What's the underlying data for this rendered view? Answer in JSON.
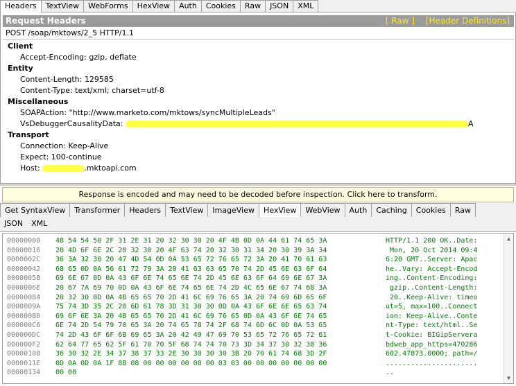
{
  "request_tabs": [
    "Headers",
    "TextView",
    "WebForms",
    "HexView",
    "Auth",
    "Cookies",
    "Raw",
    "JSON",
    "XML"
  ],
  "request_active_tab": "Headers",
  "request_panel": {
    "title": "Request Headers",
    "raw_link": "[ Raw ]",
    "defs_link": "[Header Definitions]",
    "request_line": "POST /soap/mktows/2_5 HTTP/1.1",
    "groups": {
      "client": "Client",
      "entity": "Entity",
      "misc": "Miscellaneous",
      "transport": "Transport"
    },
    "headers": {
      "accept_encoding": "Accept-Encoding: gzip, deflate",
      "content_length": "Content-Length: 129585",
      "content_type": "Content-Type: text/xml; charset=utf-8",
      "soap_action": "SOAPAction: \"http://www.marketo.com/mktows/syncMultipleLeads\"",
      "vs_debugger": "VsDebuggerCausalityData: ",
      "vs_debugger_tail": "A",
      "connection": "Connection: Keep-Alive",
      "expect": "Expect: 100-continue",
      "host_prefix": "Host: ",
      "host_suffix": ".mktoapi.com"
    }
  },
  "notice": "Response is encoded and may need to be decoded before inspection. Click here to transform.",
  "response_tabs_row1": [
    "Get SyntaxView",
    "Transformer",
    "Headers",
    "TextView",
    "ImageView",
    "HexView",
    "WebView",
    "Auth",
    "Caching",
    "Cookies",
    "Raw"
  ],
  "response_tabs_row2": [
    "JSON",
    "XML"
  ],
  "response_active_tab": "HexView",
  "hex_rows": [
    {
      "offset": "00000000",
      "bytes": "48 54 54 50 2F 31 2E 31 20 32 30 30 20 4F 4B 0D 0A 44 61 74 65 3A",
      "ascii": "HTTP/1.1 200 OK..Date:"
    },
    {
      "offset": "00000016",
      "bytes": "20 4D 6F 6E 2C 20 32 30 20 4F 63 74 20 32 30 31 34 20 30 39 3A 34",
      "ascii": " Mon, 20 Oct 2014 09:4"
    },
    {
      "offset": "0000002C",
      "bytes": "36 3A 32 30 20 47 4D 54 0D 0A 53 65 72 76 65 72 3A 20 41 70 61 63",
      "ascii": "6:20 GMT..Server: Apac"
    },
    {
      "offset": "00000042",
      "bytes": "68 65 0D 0A 56 61 72 79 3A 20 41 63 63 65 70 74 2D 45 6E 63 6F 64",
      "ascii": "he..Vary: Accept-Encod"
    },
    {
      "offset": "00000058",
      "bytes": "69 6E 67 0D 0A 43 6F 6E 74 65 6E 74 2D 45 6E 63 6F 64 69 6E 67 3A",
      "ascii": "ing..Content-Encoding:"
    },
    {
      "offset": "0000006E",
      "bytes": "20 67 7A 69 70 0D 0A 43 6F 6E 74 65 6E 74 2D 4C 65 6E 67 74 68 3A",
      "ascii": " gzip..Content-Length:"
    },
    {
      "offset": "00000084",
      "bytes": "20 32 30 0D 0A 4B 65 65 70 2D 41 6C 69 76 65 3A 20 74 69 6D 65 6F",
      "ascii": " 20..Keep-Alive: timeo"
    },
    {
      "offset": "0000009A",
      "bytes": "75 74 3D 35 2C 20 6D 61 78 3D 31 30 30 0D 0A 43 6F 6E 6E 65 63 74",
      "ascii": "ut=5, max=100..Connect"
    },
    {
      "offset": "000000B0",
      "bytes": "69 6F 6E 3A 20 4B 65 65 70 2D 41 6C 69 76 65 0D 0A 43 6F 6E 74 65",
      "ascii": "ion: Keep-Alive..Conte"
    },
    {
      "offset": "000000C6",
      "bytes": "6E 74 2D 54 79 70 65 3A 20 74 65 78 74 2F 68 74 6D 6C 0D 0A 53 65",
      "ascii": "nt-Type: text/html..Se"
    },
    {
      "offset": "000000DC",
      "bytes": "74 2D 43 6F 6F 6B 69 65 3A 20 42 49 47 69 70 53 65 72 76 65 72 61",
      "ascii": "t-Cookie: BIGipServera"
    },
    {
      "offset": "000000F2",
      "bytes": "62 64 77 65 62 5F 61 70 70 5F 68 74 74 70 73 3D 34 37 30 32 38 36",
      "ascii": "bdweb_app_https=470286"
    },
    {
      "offset": "00000108",
      "bytes": "36 30 32 2E 34 37 38 37 33 2E 30 30 30 30 3B 20 70 61 74 68 3D 2F",
      "ascii": "602.47873.0000; path=/"
    },
    {
      "offset": "0000011E",
      "bytes": "0D 0A 0D 0A 1F 8B 08 00 00 00 00 00 00 03 03 00 00 00 00 00 00 00",
      "ascii": "......................"
    },
    {
      "offset": "00000134",
      "bytes": "00 00",
      "ascii": ".."
    }
  ],
  "colors": {
    "header_bar": "#9b9b9b",
    "link_yellow": "#ffea00",
    "hex_green": "#008000",
    "offset_gray": "#808080",
    "notice_bg": "#ffffe1",
    "redaction": "#ffff3c"
  },
  "icons": {
    "scroll_up": "triangle-up",
    "scroll_down": "triangle-down"
  }
}
